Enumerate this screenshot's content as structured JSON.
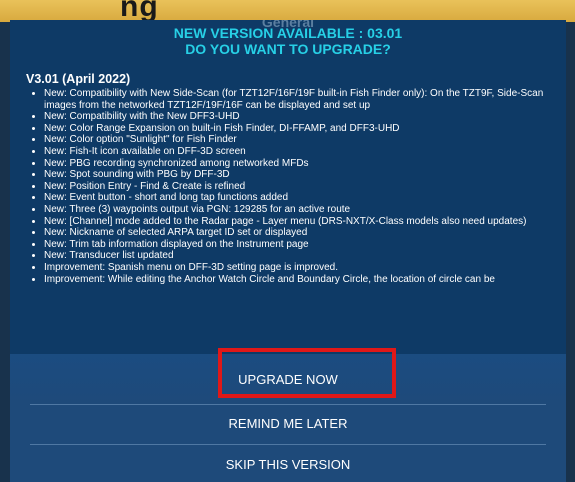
{
  "background": {
    "banner_text": "ng"
  },
  "dialog": {
    "ghost_title": "General",
    "title_line1": "NEW VERSION AVAILABLE : 03.01",
    "title_line2": "DO YOU WANT TO UPGRADE?",
    "version_heading": "V3.01 (April 2022)",
    "notes": [
      "New: Compatibility with New Side-Scan (for TZT12F/16F/19F built-in Fish Finder only): On the TZT9F, Side-Scan images from the networked TZT12F/19F/16F can be displayed and set up",
      "New: Compatibility with the New DFF3-UHD",
      "New: Color Range Expansion on built-in Fish Finder, DI-FFAMP, and DFF3-UHD",
      "New: Color option \"Sunlight\" for Fish Finder",
      "New: Fish-It icon available on DFF-3D screen",
      "New: PBG recording synchronized among networked MFDs",
      "New: Spot sounding with PBG by DFF-3D",
      "New: Position Entry - Find & Create is refined",
      "New: Event button - short and long tap functions added",
      "New: Three (3) waypoints output via PGN: 129285 for an active route",
      "New: [Channel] mode added to the Radar page - Layer menu (DRS-NXT/X-Class models also need updates)",
      "New: Nickname of selected ARPA target ID set or displayed",
      "New: Trim tab information displayed on the Instrument page",
      "New: Transducer list updated",
      "Improvement: Spanish menu on DFF-3D setting page is improved.",
      "Improvement: While editing the Anchor Watch Circle and Boundary Circle, the location of circle can be"
    ],
    "buttons": {
      "upgrade": "UPGRADE NOW",
      "remind": "REMIND ME LATER",
      "skip": "SKIP THIS VERSION"
    }
  },
  "colors": {
    "title": "#27d0e6",
    "dialog_bg": "#0e3a66",
    "highlight": "#e01818"
  }
}
